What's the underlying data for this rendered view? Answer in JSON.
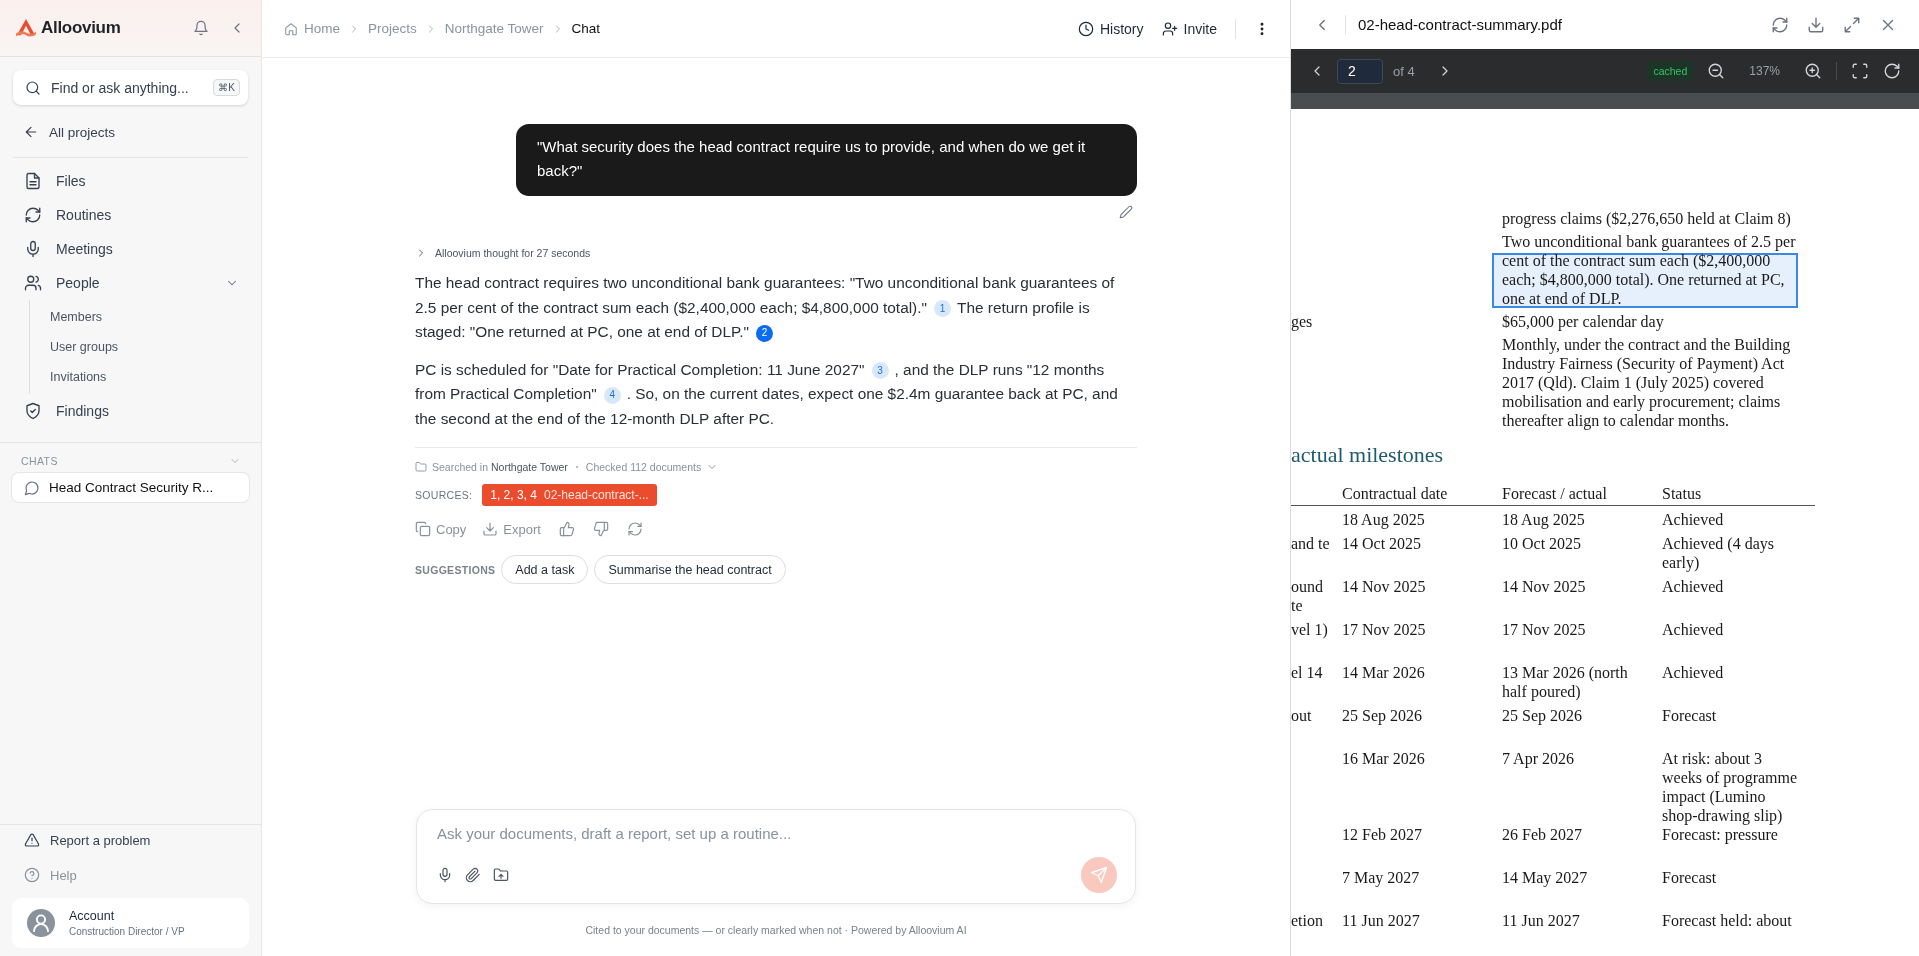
{
  "sidebar": {
    "brand": "Alloovium",
    "search": {
      "placeholder": "Find or ask anything...",
      "shortcut": "⌘K"
    },
    "back_link": "All projects",
    "nav": [
      {
        "label": "Files"
      },
      {
        "label": "Routines"
      },
      {
        "label": "Meetings"
      },
      {
        "label": "People",
        "expanded": true,
        "children": [
          {
            "label": "Members"
          },
          {
            "label": "User groups"
          },
          {
            "label": "Invitations"
          }
        ]
      },
      {
        "label": "Findings"
      }
    ],
    "chats_heading": "CHATS",
    "chats": [
      {
        "title": "Head Contract Security R...",
        "selected": true
      }
    ],
    "footer_links": [
      {
        "label": "Report a problem"
      },
      {
        "label": "Help"
      }
    ],
    "account": {
      "name": "Account",
      "role": "Construction Director / VP"
    }
  },
  "topbar": {
    "breadcrumbs": [
      "Home",
      "Projects",
      "Northgate Tower",
      "Chat"
    ],
    "actions": [
      "History",
      "Invite"
    ]
  },
  "chat": {
    "user_message": "\"What security does the head contract require us to provide, and when do we get it back?\"",
    "thought": "Alloovium thought for 27 seconds",
    "answer": [
      {
        "segments": [
          {
            "kind": "text",
            "text": "The head contract requires two unconditional bank guarantees: \"Two unconditional bank guarantees of 2.5 per cent of the contract sum each ($2,400,000 each; $4,800,000 total).\""
          },
          {
            "kind": "citation",
            "label": "1",
            "selected": false
          },
          {
            "kind": "text",
            "text": "The return profile is staged: \"One returned at PC, one at end of DLP.\""
          },
          {
            "kind": "citation",
            "label": "2",
            "selected": true
          }
        ]
      },
      {
        "segments": [
          {
            "kind": "text",
            "text": "PC is scheduled for \"Date for Practical Completion: 11 June 2027\""
          },
          {
            "kind": "citation",
            "label": "3",
            "selected": false
          },
          {
            "kind": "text",
            "text": ", and the DLP runs \"12 months from Practical Completion\""
          },
          {
            "kind": "citation",
            "label": "4",
            "selected": false
          },
          {
            "kind": "text",
            "text": ". So, on the current dates, expect one $2.4m guarantee back at PC, and the second at the end of the 12-month DLP after PC."
          }
        ]
      }
    ],
    "search_info": {
      "scope_label": "Searched in",
      "scope": "Northgate Tower",
      "checked": "Checked 112 documents"
    },
    "sources": {
      "label": "SOURCES:",
      "chips": [
        {
          "refs": "1, 2, 3, 4",
          "file": "02-head-contract-..."
        }
      ]
    },
    "actions": [
      "Copy",
      "Export"
    ],
    "suggestions": {
      "label": "SUGGESTIONS",
      "items": [
        "Add a task",
        "Summarise the head contract"
      ]
    }
  },
  "composer": {
    "placeholder": "Ask your documents, draft a report, set up a routine...",
    "send_disabled": true
  },
  "footer": "Cited to your documents — or clearly marked when not · Powered by Alloovium AI",
  "pdf": {
    "filename": "02-head-contract-summary.pdf",
    "page": "2",
    "page_count": "of 4",
    "cache_status": "cached",
    "zoom": "137%",
    "terms": [
      {
        "value": "progress claims ($2,276,650 held at Claim 8)",
        "highlighted": false
      },
      {
        "value": "Two unconditional bank guarantees of 2.5 per cent of the contract sum each ($2,400,000 each; $4,800,000 total). One returned at PC, one at end of DLP.",
        "highlighted": true
      },
      {
        "key": "ges",
        "value": "$65,000 per calendar day",
        "highlighted": false
      },
      {
        "value": "Monthly, under the contract and the Building Industry Fairness (Security of Payment) Act 2017 (Qld). Claim 1 (July 2025) covered mobilisation and early procurement; claims thereafter align to calendar months.",
        "highlighted": false
      }
    ],
    "heading": "actual milestones",
    "columns": [
      "Contractual date",
      "Forecast / actual",
      "Status"
    ],
    "rows": [
      {
        "contractual": "18 Aug 2025",
        "forecast": "18 Aug 2025",
        "status": "Achieved"
      },
      {
        "column_1": "and te",
        "contractual": "14 Oct 2025",
        "forecast": "10 Oct 2025",
        "status": "Achieved (4 days early)"
      },
      {
        "column_1": "ound te",
        "contractual": "14 Nov 2025",
        "forecast": "14 Nov 2025",
        "status": "Achieved"
      },
      {
        "column_1": "vel 1)",
        "contractual": "17 Nov 2025",
        "forecast": "17 Nov 2025",
        "status": "Achieved"
      },
      {
        "column_1": "el 14",
        "contractual": "14 Mar 2026",
        "forecast": "13 Mar 2026 (north half poured)",
        "status": "Achieved"
      },
      {
        "column_1": "out",
        "contractual": "25 Sep 2026",
        "forecast": "25 Sep 2026",
        "status": "Forecast"
      },
      {
        "contractual": "16 Mar 2026",
        "forecast": "7 Apr 2026",
        "status": "At risk: about 3 weeks of programme impact (Lumino shop-drawing slip)"
      },
      {
        "contractual": "12 Feb 2027",
        "forecast": "26 Feb 2027",
        "status": "Forecast: pressure"
      },
      {
        "contractual": "7 May 2027",
        "forecast": "14 May 2027",
        "status": "Forecast"
      },
      {
        "column_1": "etion",
        "contractual": "11 Jun 2027",
        "forecast": "11 Jun 2027",
        "status": "Forecast held: about"
      }
    ]
  }
}
